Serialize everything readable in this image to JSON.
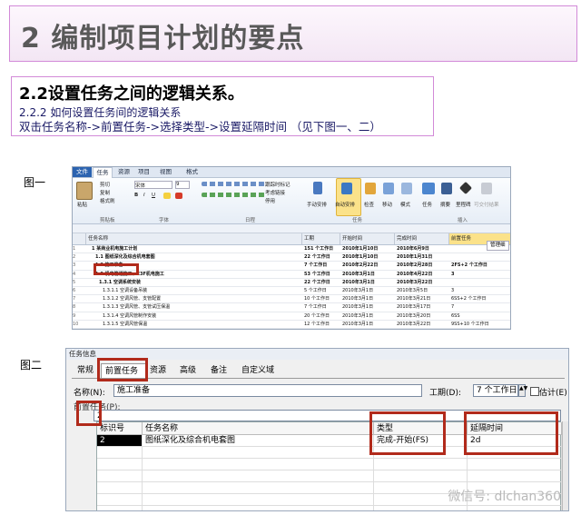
{
  "title": "2 编制项目计划的要点",
  "section": {
    "heading": "2.2设置任务之间的逻辑关系。",
    "sub": "2.2.2 如何设置任务间的逻辑关系",
    "instruction": "双击任务名称->前置任务->选择类型->设置延隔时间 （见下图一、二）"
  },
  "fig1_label": "图一",
  "fig2_label": "图二",
  "fig1": {
    "tabs": [
      "文件",
      "任务",
      "资源",
      "项目",
      "视图",
      "格式"
    ],
    "ribbon": {
      "paste": "粘贴",
      "cut": "剪切",
      "copy": "复制",
      "format_painter": "格式刷",
      "font_name": "宋体",
      "font_size": "9",
      "mark_track": "跟踪时标记",
      "respect_links": "考虑链接",
      "inactivate": "停用",
      "manual_schedule": "手动安排",
      "auto_schedule": "自动安排",
      "inspect": "检查",
      "move": "移动",
      "mode": "模式",
      "task": "任务",
      "summary": "摘要",
      "milestone": "里程碑",
      "deliverable": "可交付结果",
      "groups": [
        "剪贴板",
        "字体",
        "日程",
        "任务",
        "插入"
      ]
    },
    "predecessor_header": "前置任务",
    "manage_button": "管理细",
    "columns": [
      "任务名称",
      "工期",
      "开始时间",
      "完成时间",
      "前置任务"
    ],
    "rows": [
      {
        "n": "1",
        "name": "1 某商业机电施工计划",
        "dur": "151 个工作日",
        "start": "2010年1月10日",
        "finish": "2010年6月9日",
        "pred": "",
        "bold": true
      },
      {
        "n": "2",
        "name": "1.1 图纸深化及综合机电套图",
        "dur": "22 个工作日",
        "start": "2010年1月10日",
        "finish": "2010年1月31日",
        "pred": "",
        "bold": true
      },
      {
        "n": "3",
        "name": "1.2 施工准备",
        "dur": "7 个工作日",
        "start": "2010年2月22日",
        "finish": "2010年2月28日",
        "pred": "2FS+2 个工作日",
        "bold": true
      },
      {
        "n": "4",
        "name": "1.3 机电管道施工、E3F机电施工",
        "dur": "53 个工作日",
        "start": "2010年3月1日",
        "finish": "2010年4月22日",
        "pred": "3",
        "bold": true
      },
      {
        "n": "5",
        "name": "1.3.1 空调系统安装",
        "dur": "22 个工作日",
        "start": "2010年3月1日",
        "finish": "2010年3月22日",
        "pred": "",
        "bold": true
      },
      {
        "n": "6",
        "name": "1.3.1.1 空调设备吊装",
        "dur": "5 个工作日",
        "start": "2010年3月1日",
        "finish": "2010年3月5日",
        "pred": "3",
        "bold": false
      },
      {
        "n": "7",
        "name": "1.3.1.2 空调风管、支管配置",
        "dur": "10 个工作日",
        "start": "2010年3月1日",
        "finish": "2010年3月21日",
        "pred": "6SS+2 个工作日",
        "bold": false
      },
      {
        "n": "8",
        "name": "1.3.1.3 空调风管、支管试压保温",
        "dur": "7 个工作日",
        "start": "2010年3月1日",
        "finish": "2010年3月17日",
        "pred": "7",
        "bold": false
      },
      {
        "n": "9",
        "name": "1.3.1.4 空调风管制作安装",
        "dur": "20 个工作日",
        "start": "2010年3月1日",
        "finish": "2010年3月20日",
        "pred": "6SS",
        "bold": false
      },
      {
        "n": "10",
        "name": "1.3.1.5 空调风管保温",
        "dur": "12 个工作日",
        "start": "2010年3月1日",
        "finish": "2010年3月22日",
        "pred": "9SS+10 个工作日",
        "bold": false
      }
    ]
  },
  "fig2": {
    "window_title": "任务信息",
    "tabs": [
      "常规",
      "前置任务",
      "资源",
      "高级",
      "备注",
      "自定义域"
    ],
    "name_label": "名称(N):",
    "name_value": "施工准备",
    "duration_label": "工期(D):",
    "duration_value": "7 个工作日",
    "estimate_label": "估计(E)",
    "predecessor_section": "前置任务(P):",
    "entry_value": "2",
    "columns": [
      "标识号",
      "任务名称",
      "类型",
      "延隔时间"
    ],
    "rows": [
      {
        "id": "2",
        "name": "图纸深化及综合机电套图",
        "type": "完成-开始(FS)",
        "lag": "2d"
      }
    ],
    "watermark": "微信号: dlchan360"
  }
}
